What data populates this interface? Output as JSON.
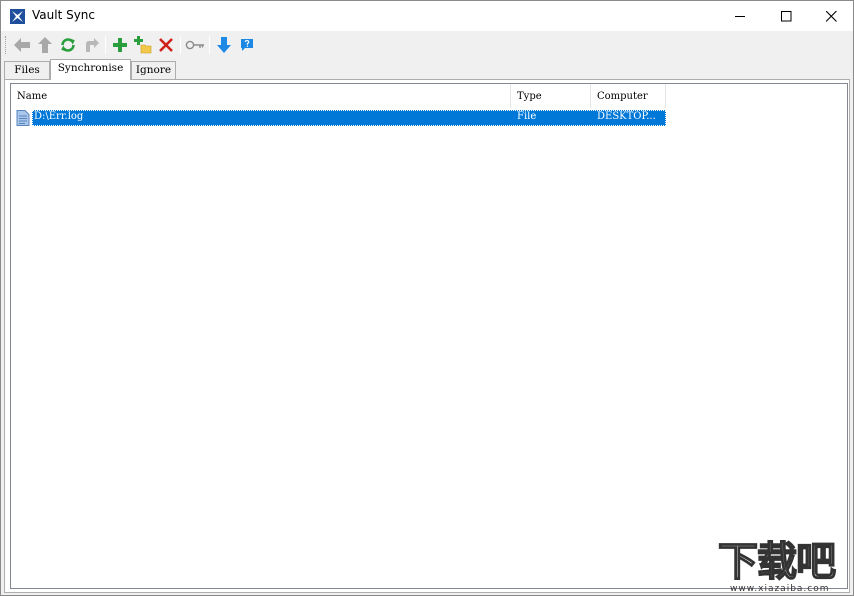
{
  "window": {
    "title": "Vault Sync"
  },
  "toolbar": {
    "buttons": [
      {
        "icon": "back-arrow-icon"
      },
      {
        "icon": "up-arrow-icon"
      },
      {
        "icon": "refresh-icon"
      },
      {
        "icon": "forward-icon"
      },
      {
        "icon": "add-icon"
      },
      {
        "icon": "add-folder-icon"
      },
      {
        "icon": "delete-icon"
      },
      {
        "icon": "key-icon"
      },
      {
        "icon": "download-icon"
      },
      {
        "icon": "help-icon"
      }
    ]
  },
  "tabs": [
    {
      "label": "Files",
      "active": false
    },
    {
      "label": "Synchronise",
      "active": true
    },
    {
      "label": "Ignore",
      "active": false
    }
  ],
  "list": {
    "columns": [
      "Name",
      "Type",
      "Computer"
    ],
    "rows": [
      {
        "name": "D:\\Err.log",
        "type": "File",
        "computer": "DESKTOP...",
        "selected": true
      }
    ]
  },
  "watermark": {
    "main": "下载吧",
    "sub": "www.xiazaiba.com"
  },
  "colors": {
    "selection": "#0078d7",
    "accent_green": "#2a9d3c",
    "accent_red": "#d0201a",
    "accent_blue": "#1e88e5"
  }
}
